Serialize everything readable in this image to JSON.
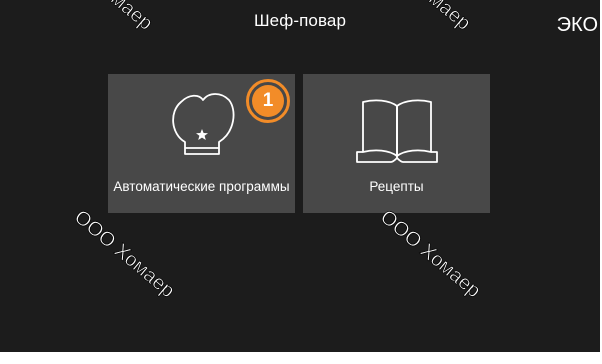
{
  "header": {
    "title": "Шеф-повар",
    "mode_label": "ЭКО"
  },
  "tiles": [
    {
      "label": "Автоматические программы",
      "icon": "chef-hat-icon",
      "badge": "1"
    },
    {
      "label": "Рецепты",
      "icon": "open-book-icon"
    }
  ],
  "watermarks": [
    "Хомаер",
    "Хомаер",
    "ООО Хомаер",
    "ООО Хомаер"
  ],
  "colors": {
    "screen_background": "#1c1c1c",
    "tile_background": "#484848",
    "badge_accent": "#f28c28",
    "text": "#ffffff"
  }
}
